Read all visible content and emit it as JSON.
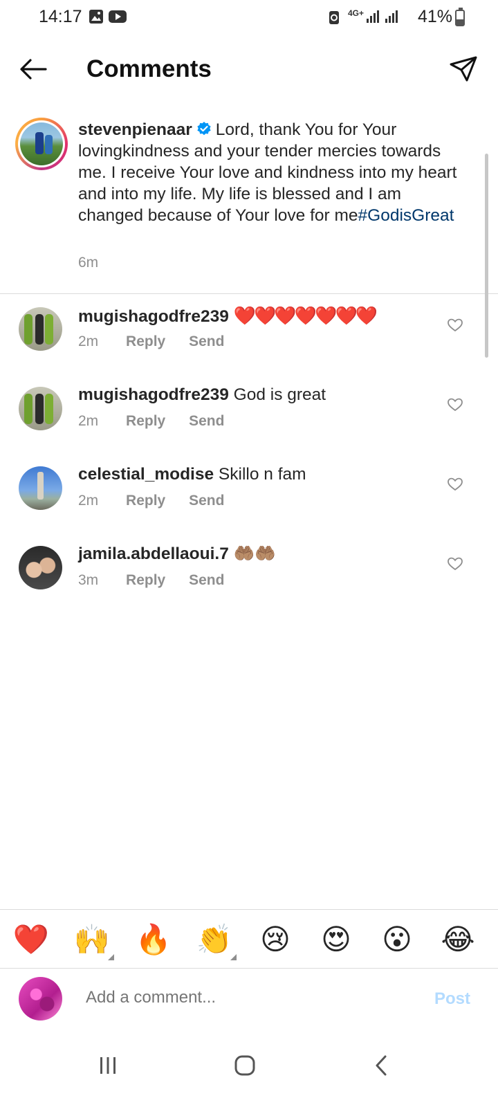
{
  "status_bar": {
    "time": "14:17",
    "network": "4G+",
    "battery_text": "41%",
    "battery_level": 0.41
  },
  "header": {
    "title": "Comments"
  },
  "caption": {
    "username": "stevenpienaar",
    "text": "Lord, thank You for Your lovingkindness and your tender mercies towards me. I receive Your love and kindness into my heart and into my life. My life is blessed and I am changed because of Your love for me",
    "hashtag": "#GodisGreat",
    "time": "6m"
  },
  "comments": [
    {
      "username": "mugishagodfre239",
      "text": "❤️❤️❤️❤️❤️❤️❤️",
      "time": "2m",
      "reply_label": "Reply",
      "send_label": "Send"
    },
    {
      "username": "mugishagodfre239",
      "text": "God is great",
      "time": "2m",
      "reply_label": "Reply",
      "send_label": "Send"
    },
    {
      "username": "celestial_modise",
      "text": "Skillo n fam",
      "time": "2m",
      "reply_label": "Reply",
      "send_label": "Send"
    },
    {
      "username": "jamila.abdellaoui.7",
      "text": "🤲🏽🤲🏽",
      "time": "3m",
      "reply_label": "Reply",
      "send_label": "Send"
    }
  ],
  "reactions": [
    "❤️",
    "🙌",
    "🔥",
    "👏",
    "😢",
    "😍",
    "😮",
    "😂"
  ],
  "composer": {
    "placeholder": "Add a comment...",
    "post_label": "Post"
  },
  "colors": {
    "hashtag": "#00376b",
    "post_disabled": "#b3dbff",
    "secondary_text": "#8e8e8e",
    "verified": "#0095f6"
  }
}
